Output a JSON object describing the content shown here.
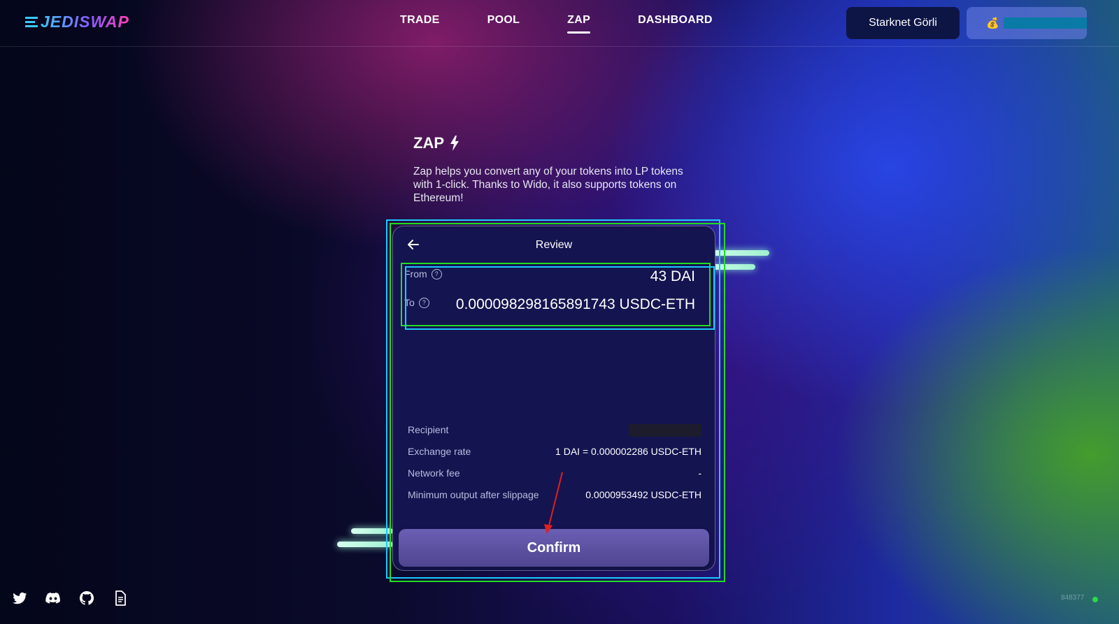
{
  "brand": {
    "name": "JEDISWAP"
  },
  "nav": {
    "items": [
      {
        "label": "TRADE"
      },
      {
        "label": "POOL"
      },
      {
        "label": "ZAP"
      },
      {
        "label": "DASHBOARD"
      }
    ],
    "active": "ZAP"
  },
  "network": {
    "label": "Starknet Görli"
  },
  "wallet": {
    "icon": "money-bag-icon"
  },
  "zap": {
    "title": "ZAP",
    "description": "Zap helps you convert any of your tokens into LP tokens with 1-click. Thanks to Wido, it also supports tokens on Ethereum!"
  },
  "review": {
    "title": "Review",
    "from_label": "From",
    "from_amount": "43 DAI",
    "to_label": "To",
    "to_amount": "0.000098298165891743 USDC-ETH",
    "details": [
      {
        "label": "Recipient",
        "value": ""
      },
      {
        "label": "Exchange rate",
        "value": "1 DAI = 0.000002286 USDC-ETH"
      },
      {
        "label": "Network fee",
        "value": "-"
      },
      {
        "label": "Minimum output after slippage",
        "value": "0.0000953492 USDC-ETH"
      }
    ],
    "confirm_label": "Confirm"
  },
  "footer": {
    "block_number": "848377"
  },
  "colors": {
    "accent": "#141450",
    "status": "#2bd94a",
    "annotation_cyan": "#1ec8ff",
    "annotation_green": "#22dd22"
  }
}
